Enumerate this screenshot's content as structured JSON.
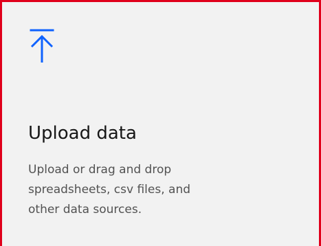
{
  "tile": {
    "icon": "upload-icon",
    "title": "Upload data",
    "description_lines": [
      "Upload or drag and drop",
      "spreadsheets, csv files, and",
      "other data sources."
    ]
  },
  "colors": {
    "tile_background": "#f2f2f2",
    "highlight_border": "#e0001b",
    "icon": "#0f62fe",
    "title_text": "#161616",
    "description_text": "#525252"
  }
}
